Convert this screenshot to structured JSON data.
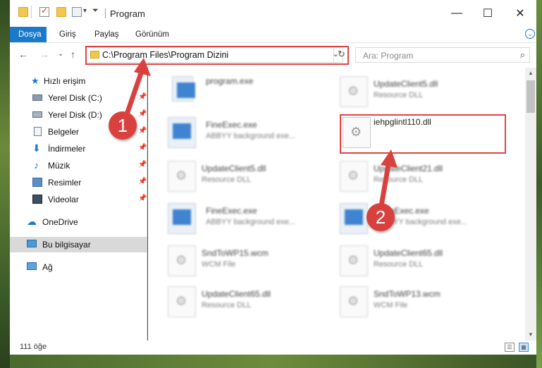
{
  "window": {
    "title": "Program",
    "minimize": "—",
    "maximize": "☐",
    "close": "✕"
  },
  "ribbon": {
    "tabs": [
      "Dosya",
      "Giriş",
      "Paylaş",
      "Görünüm"
    ],
    "expand": "⌄"
  },
  "nav": {
    "back": "←",
    "forward": "→",
    "recent": "⌄",
    "up": "↑",
    "address": "C:\\Program Files\\Program Dizini",
    "address_chevron": "⌄",
    "refresh": "↻",
    "search_placeholder": "Ara: Program",
    "search_icon": "⌕"
  },
  "sidebar": {
    "items": [
      {
        "label": "Hızlı erişim",
        "icon": "star-icon"
      },
      {
        "label": "Yerel Disk (C:)",
        "icon": "drive-icon"
      },
      {
        "label": "Yerel Disk (D:)",
        "icon": "drive-icon"
      },
      {
        "label": "Belgeler",
        "icon": "documents-icon"
      },
      {
        "label": "İndirmeler",
        "icon": "download-icon"
      },
      {
        "label": "Müzik",
        "icon": "music-icon"
      },
      {
        "label": "Resimler",
        "icon": "pictures-icon"
      },
      {
        "label": "Videolar",
        "icon": "videos-icon"
      },
      {
        "label": "OneDrive",
        "icon": "cloud-icon"
      },
      {
        "label": "Bu bilgisayar",
        "icon": "computer-icon"
      },
      {
        "label": "Ağ",
        "icon": "network-icon"
      }
    ],
    "pin_glyph": "📌"
  },
  "files": [
    {
      "name": "program.exe",
      "desc": "",
      "kind": "exe"
    },
    {
      "name": "UpdateClient5.dll",
      "desc": "Resource DLL",
      "kind": "dll"
    },
    {
      "name": "FineExec.exe",
      "desc": "ABBYY background exe...",
      "kind": "exe"
    },
    {
      "name": "iehpglintl110.dll",
      "desc": "",
      "kind": "dll"
    },
    {
      "name": "UpdateClient5.dll",
      "desc": "Resource DLL",
      "kind": "dll"
    },
    {
      "name": "UpdateClient21.dll",
      "desc": "Resource DLL",
      "kind": "dll"
    },
    {
      "name": "FineExec.exe",
      "desc": "ABBYY background exe...",
      "kind": "exe"
    },
    {
      "name": "FineExec.exe",
      "desc": "ABBYY background exe...",
      "kind": "exe"
    },
    {
      "name": "SndToWP15.wcm",
      "desc": "WCM File",
      "kind": "dll"
    },
    {
      "name": "UpdateClient65.dll",
      "desc": "Resource DLL",
      "kind": "dll"
    },
    {
      "name": "UpdateClient65.dll",
      "desc": "Resource DLL",
      "kind": "dll"
    },
    {
      "name": "SndToWP13.wcm",
      "desc": "WCM File",
      "kind": "dll"
    }
  ],
  "status": {
    "count": "111 öğe",
    "details_view": "☰",
    "icons_view": "▦"
  },
  "annotations": {
    "badge1": "1",
    "badge2": "2"
  },
  "colors": {
    "accent": "#1979ca",
    "highlight_red": "#e04343",
    "badge_red": "#d9413f",
    "selected_bg": "#d9d9d9"
  }
}
